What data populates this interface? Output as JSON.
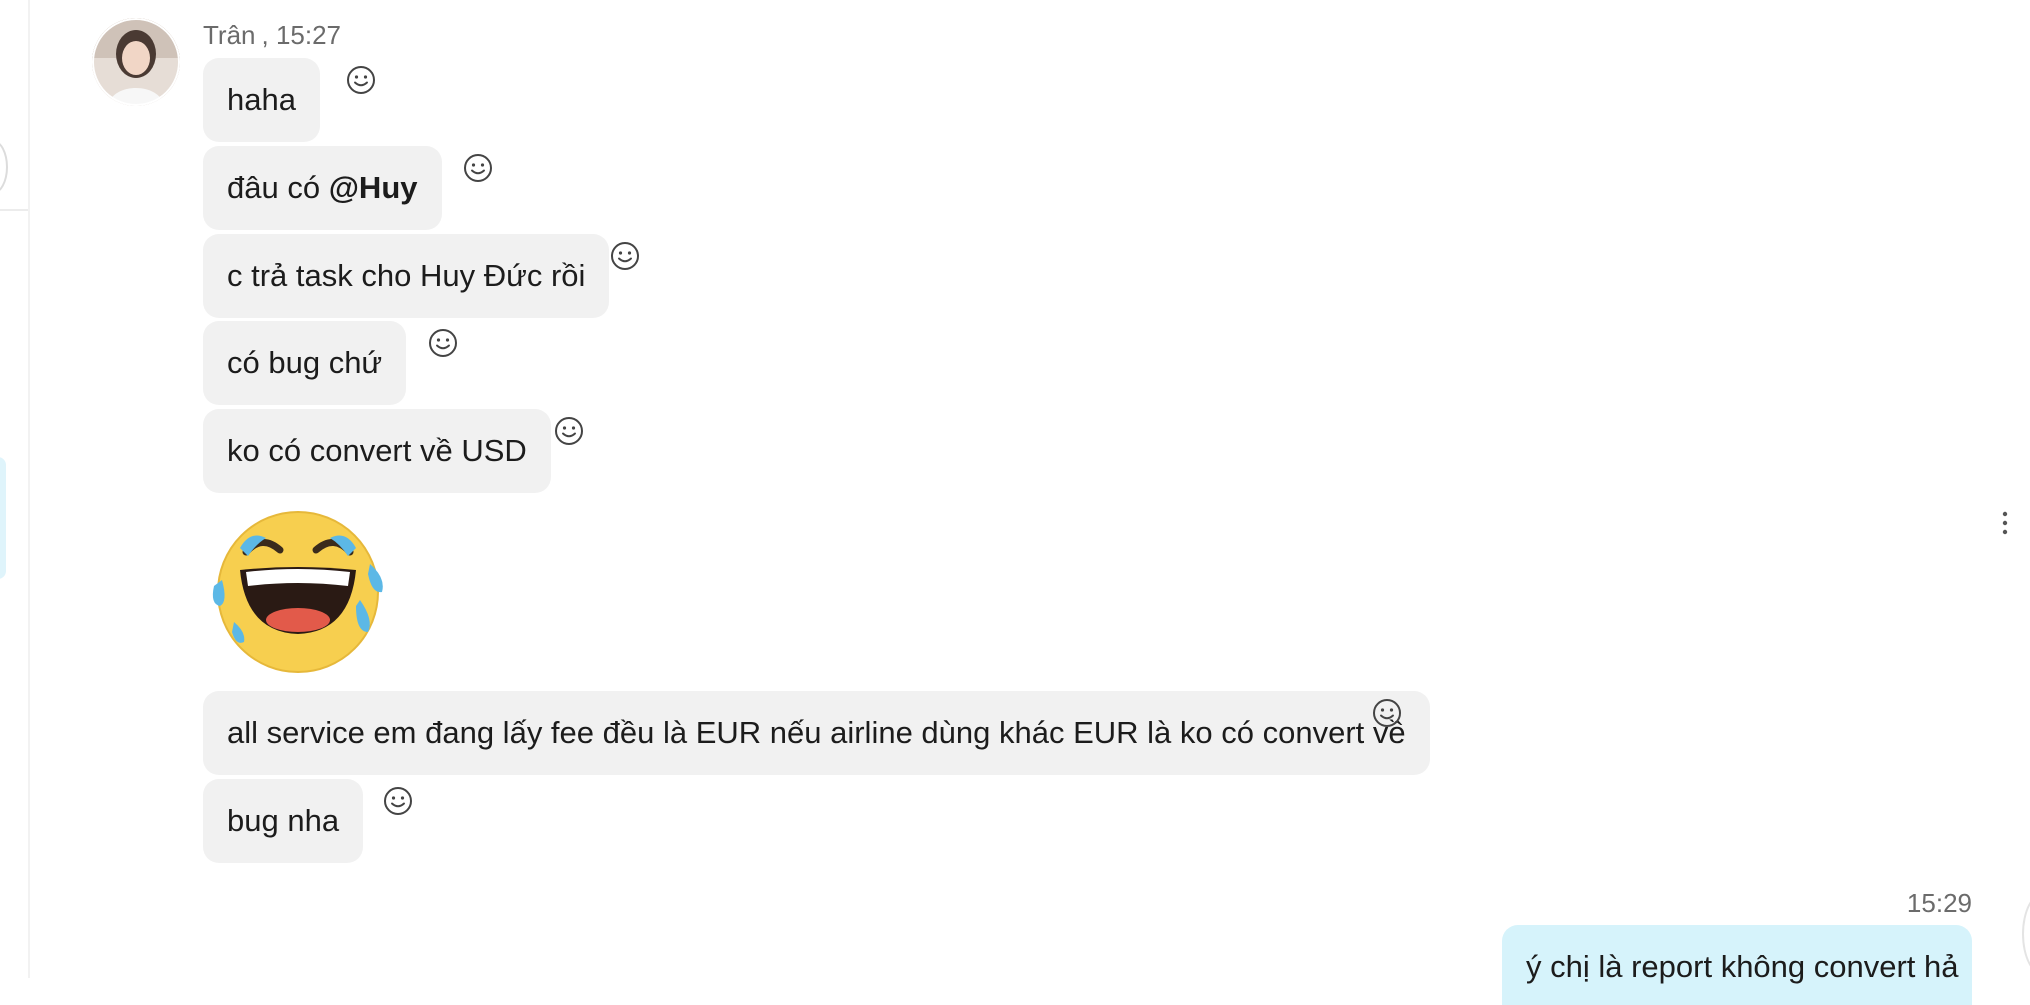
{
  "conversation": {
    "sender": {
      "name": "Trân",
      "time": "15:27"
    },
    "messages": [
      {
        "text": "haha"
      },
      {
        "prefix": "đâu có ",
        "mention": "@Huy"
      },
      {
        "text": "c trả task cho Huy Đức rồi"
      },
      {
        "text": "có bug chứ"
      },
      {
        "text": "ko có convert về USD"
      },
      {
        "sticker": "laughing-tears-emoji"
      },
      {
        "text": "all service em đang lấy fee đều là EUR nếu airline dùng khác EUR là ko có convert về"
      },
      {
        "text": "bug nha"
      }
    ],
    "outgoing": {
      "time": "15:29",
      "text": "ý chị là report không convert hả"
    }
  },
  "icons": {
    "react": "smiley-react-icon",
    "more": "more-vertical-icon",
    "avatar": "user-avatar"
  },
  "colors": {
    "incoming_bubble": "#f1f1f1",
    "outgoing_bubble": "#d6f3fb",
    "meta_text": "#6b6b6b"
  }
}
